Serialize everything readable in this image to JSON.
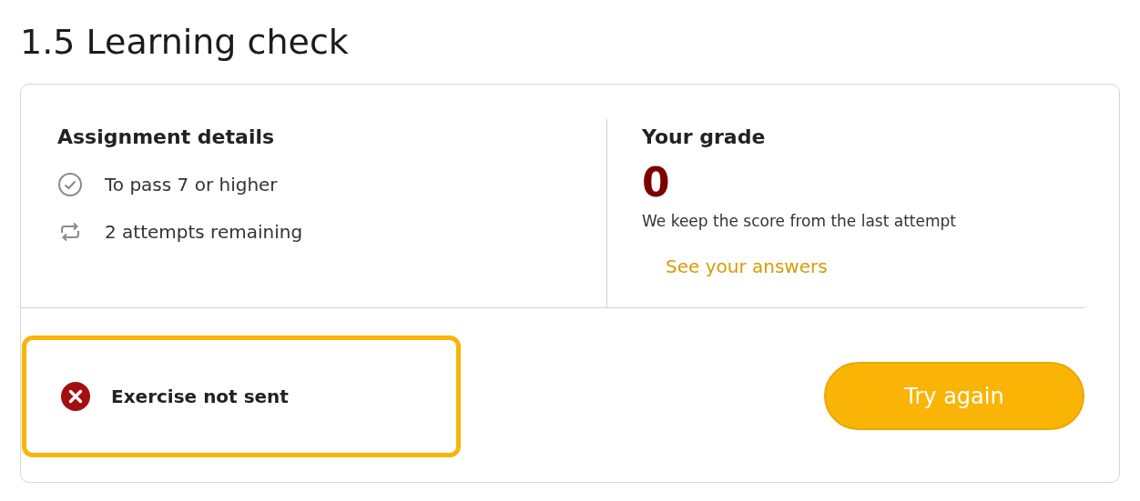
{
  "page_title": "1.5 Learning check",
  "assignment": {
    "heading": "Assignment details",
    "items": [
      {
        "kind": "check",
        "text": "To pass 7 or higher"
      },
      {
        "kind": "repeat",
        "text": "2 attempts remaining"
      }
    ]
  },
  "grade": {
    "heading": "Your grade",
    "value": "0",
    "note": "We keep the score from the last attempt",
    "link": "See your answers"
  },
  "status": {
    "kind": "error",
    "text": "Exercise not sent",
    "highlighted": true
  },
  "button": {
    "label": "Try again"
  }
}
